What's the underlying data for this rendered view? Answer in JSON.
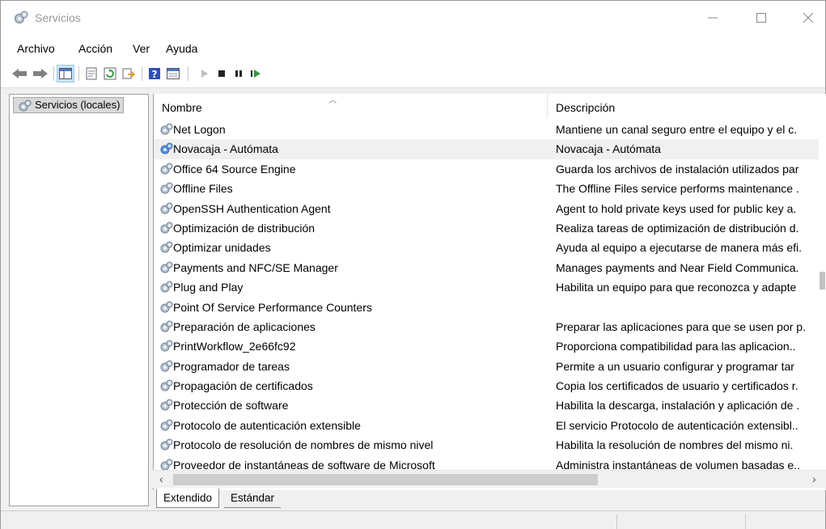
{
  "window": {
    "title": "Servicios"
  },
  "menu": [
    "Archivo",
    "Acción",
    "Ver",
    "Ayuda"
  ],
  "toolbar": {
    "buttons": [
      "back-arrow-icon",
      "forward-arrow-icon",
      "show-hide-tree-icon",
      "properties-icon",
      "refresh-icon",
      "export-list-icon",
      "help-icon",
      "view-icon",
      "start-service-icon",
      "stop-service-icon",
      "pause-service-icon",
      "restart-service-icon"
    ]
  },
  "tree": {
    "root": "Servicios (locales)"
  },
  "columns": {
    "name": "Nombre",
    "description": "Descripción"
  },
  "services": [
    {
      "name": "Net Logon",
      "description": "Mantiene un canal seguro entre el equipo y el c."
    },
    {
      "name": "Novacaja - Autómata",
      "description": "Novacaja - Autómata"
    },
    {
      "name": "Office 64 Source Engine",
      "description": "Guarda los archivos de instalación utilizados par"
    },
    {
      "name": "Offline Files",
      "description": "The Offline Files service performs maintenance ."
    },
    {
      "name": "OpenSSH Authentication Agent",
      "description": "Agent to hold private keys used for public key a."
    },
    {
      "name": "Optimización de distribución",
      "description": "Realiza tareas de optimización de distribución d."
    },
    {
      "name": "Optimizar unidades",
      "description": "Ayuda al equipo a ejecutarse de manera más efi."
    },
    {
      "name": "Payments and NFC/SE Manager",
      "description": "Manages payments and Near Field Communica."
    },
    {
      "name": "Plug and Play",
      "description": "Habilita un equipo para que reconozca y adapte"
    },
    {
      "name": "Point Of Service Performance Counters",
      "description": ""
    },
    {
      "name": "Preparación de aplicaciones",
      "description": "Preparar las aplicaciones para que se usen por p."
    },
    {
      "name": "PrintWorkflow_2e66fc92",
      "description": "Proporciona compatibilidad para las aplicacion.."
    },
    {
      "name": "Programador de tareas",
      "description": "Permite a un usuario configurar y programar tar"
    },
    {
      "name": "Propagación de certificados",
      "description": "Copia los certificados de usuario y certificados r."
    },
    {
      "name": "Protección de software",
      "description": "Habilita la descarga, instalación y aplicación de ."
    },
    {
      "name": "Protocolo de autenticación extensible",
      "description": "El servicio Protocolo de autenticación extensibl.."
    },
    {
      "name": "Protocolo de resolución de nombres de mismo nivel",
      "description": "Habilita la resolución de nombres del mismo ni."
    },
    {
      "name": "Proveedor de instantáneas de software de Microsoft",
      "description": "Administra instantáneas de volumen basadas e.."
    }
  ],
  "selected_row": 1,
  "tabs": [
    "Extendido",
    "Estándar"
  ]
}
